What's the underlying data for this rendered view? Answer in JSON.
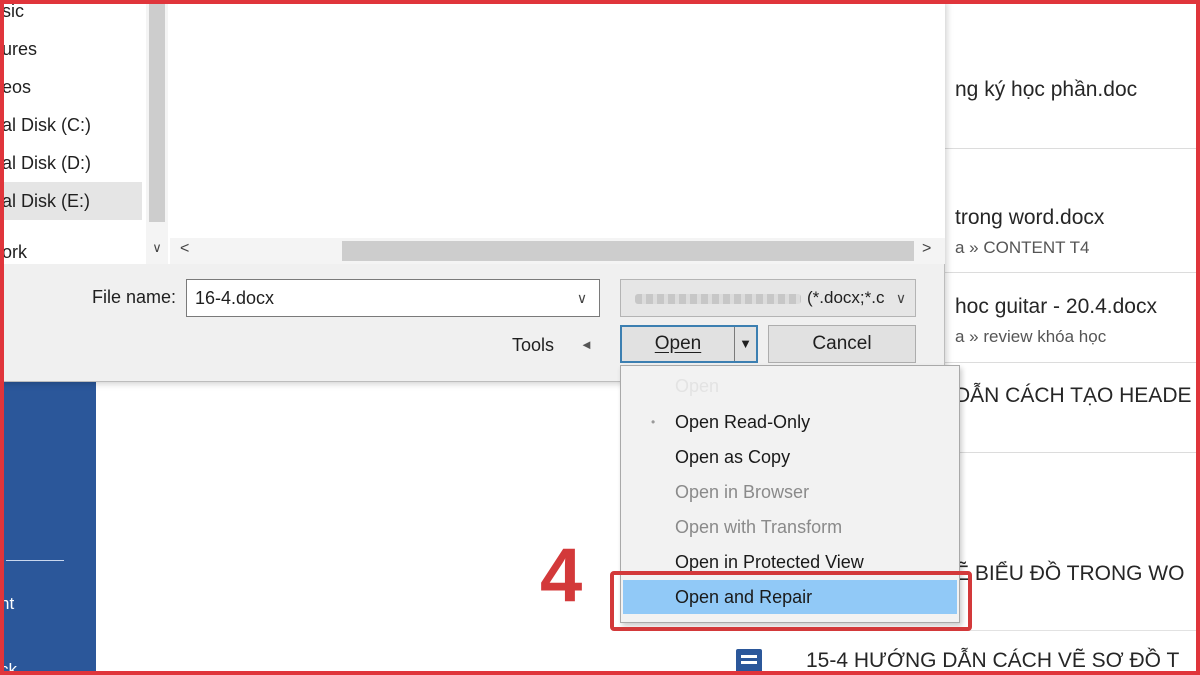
{
  "nav_pane": {
    "items": [
      {
        "label": "sic"
      },
      {
        "label": "ures"
      },
      {
        "label": "eos"
      },
      {
        "label": "al Disk (C:)"
      },
      {
        "label": "al Disk (D:)"
      },
      {
        "label": "al Disk (E:)"
      },
      {
        "label": "ork"
      }
    ]
  },
  "dialog": {
    "file_name_label": "File name:",
    "file_name_value": "16-4.docx",
    "file_type_value": "(*.docx;*.c",
    "tools_label": "Tools",
    "open_label": "Open",
    "cancel_label": "Cancel"
  },
  "open_menu": {
    "items": [
      {
        "label": "Open Read-Only",
        "enabled": true
      },
      {
        "label": "Open as Copy",
        "enabled": true
      },
      {
        "label": "Open in Browser",
        "enabled": false
      },
      {
        "label": "Open with Transform",
        "enabled": false
      },
      {
        "label": "Open in Protected View",
        "enabled": true
      },
      {
        "label": "Open and Repair",
        "enabled": true,
        "highlighted": true
      }
    ]
  },
  "annotation": {
    "step_number": "4",
    "color": "#d3393a"
  },
  "backstage": {
    "left_labels": [
      "nt",
      "ck"
    ],
    "accent_color": "#2b579a"
  },
  "recent_files": [
    {
      "name": "ng ký học phần.doc",
      "path": ""
    },
    {
      "name": "trong word.docx",
      "path": "a » CONTENT T4"
    },
    {
      "name": "hoc guitar - 20.4.docx",
      "path": "a » review khóa học"
    },
    {
      "name": "DẪN CÁCH TẠO HEADE",
      "path": ""
    },
    {
      "name": "Ẽ BIỂU ĐỒ TRONG WO",
      "path": ""
    },
    {
      "name": "15-4 HƯỚNG DẪN CÁCH VẼ SƠ ĐỒ T",
      "path": ""
    }
  ],
  "icons": {
    "chevron_down": "▼",
    "scroll_left": "<",
    "scroll_right": ">",
    "nav_down": "∨",
    "tools_arrow": "◄",
    "drop_arrow": "▼"
  }
}
